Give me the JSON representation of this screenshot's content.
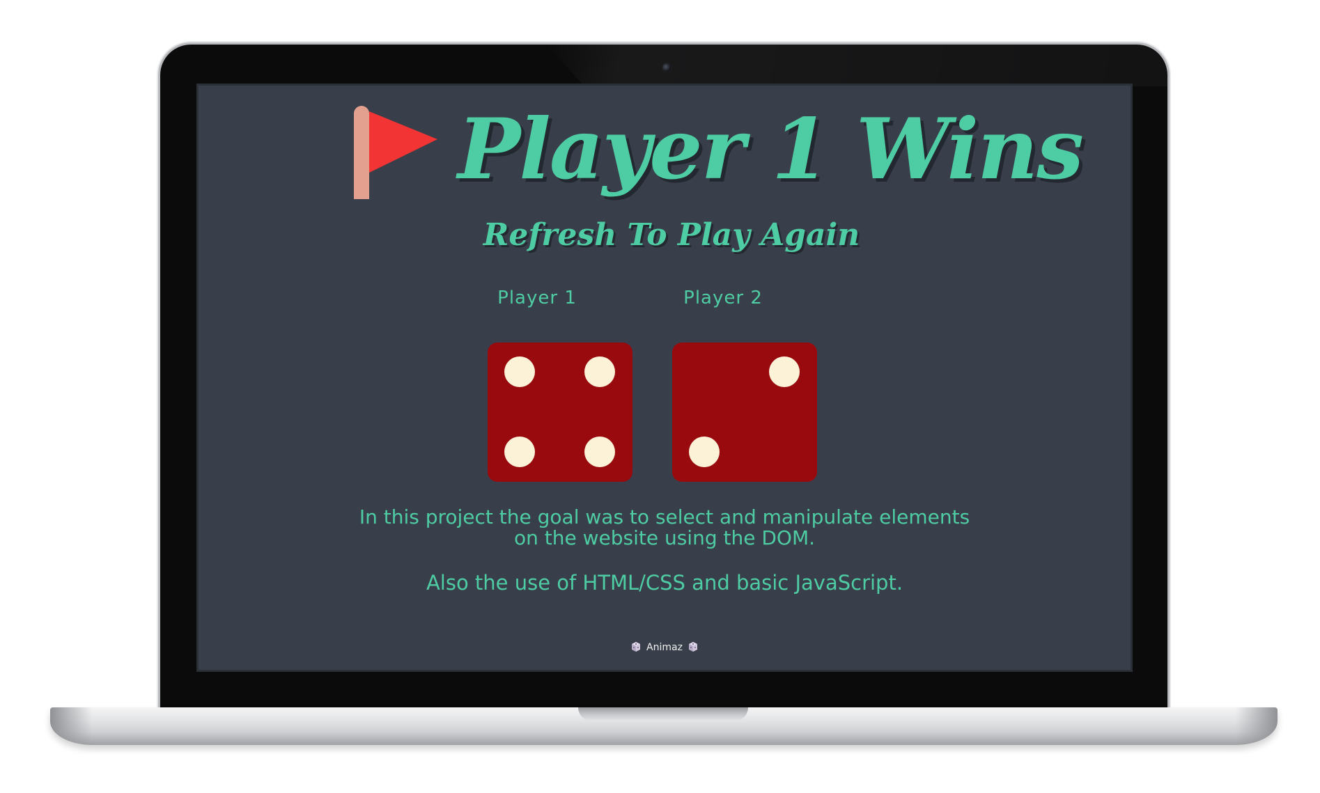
{
  "game": {
    "title": "Player 1 Wins",
    "subtitle": "Refresh To Play Again",
    "players": [
      {
        "label": "Player 1",
        "die_value": 4
      },
      {
        "label": "Player 2",
        "die_value": 2
      }
    ]
  },
  "description": {
    "line1": "In this project the goal was to select and manipulate elements",
    "line2": "on the website using the DOM.",
    "line3": "Also the use of HTML/CSS and basic JavaScript."
  },
  "footer": {
    "credit": "Animaz"
  },
  "icons": {
    "title_icon": "red-flag-icon",
    "footer_icon": "game-die-icon"
  },
  "colors": {
    "background": "#393f4a",
    "accent": "#4ecca3",
    "die_face": "#990a0f",
    "pip": "#fbf2d8",
    "flag": "#f23434",
    "flag_pole": "#e3a08f"
  }
}
